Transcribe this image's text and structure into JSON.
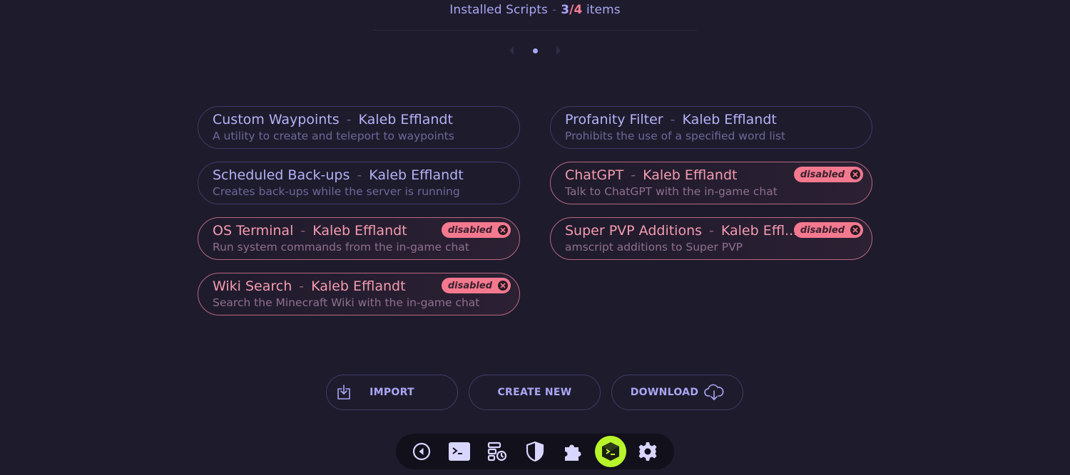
{
  "header": {
    "title": "Installed Scripts",
    "separator": "-",
    "count_enabled": "3",
    "count_slash": "/",
    "count_total": "4",
    "count_suffix": "items"
  },
  "pagination": {
    "current_page": 1,
    "total_pages": 1
  },
  "scripts": [
    {
      "title": "Custom Waypoints",
      "author": "Kaleb Efflandt",
      "description": "A utility to create and teleport to waypoints",
      "disabled": false
    },
    {
      "title": "Profanity Filter",
      "author": "Kaleb Efflandt",
      "description": "Prohibits the use of a specified word list",
      "disabled": false
    },
    {
      "title": "Scheduled Back-ups",
      "author": "Kaleb Efflandt",
      "description": "Creates back-ups while the server is running",
      "disabled": false
    },
    {
      "title": "ChatGPT",
      "author": "Kaleb Efflandt",
      "description": "Talk to ChatGPT with the in-game chat",
      "disabled": true
    },
    {
      "title": "OS Terminal",
      "author": "Kaleb Efflandt",
      "description": "Run system commands from the in-game chat",
      "disabled": true
    },
    {
      "title": "Super PVP Additions",
      "author": "Kaleb Effl...",
      "description": "amscript additions to Super PVP",
      "disabled": true
    },
    {
      "title": "Wiki Search",
      "author": "Kaleb Efflandt",
      "description": "Search the Minecraft Wiki with the in-game chat",
      "disabled": true
    }
  ],
  "badge_label": "disabled",
  "dash": "-",
  "buttons": {
    "import": "IMPORT",
    "create_new": "CREATE NEW",
    "download": "DOWNLOAD"
  },
  "dock": {
    "items": [
      "back-icon",
      "terminal-icon",
      "backups-icon",
      "shield-icon",
      "puzzle-icon",
      "amscript-icon",
      "gear-icon"
    ],
    "active": "amscript-icon"
  },
  "colors": {
    "background": "#1e1b2c",
    "accent": "#a9a7f5",
    "disabled": "#f4798f",
    "active": "#b7f42a"
  }
}
